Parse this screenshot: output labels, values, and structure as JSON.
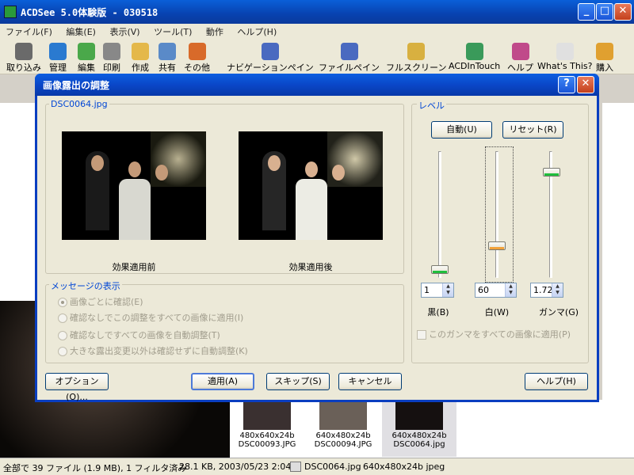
{
  "app": {
    "title": "ACDSee 5.0体験版 - 030518",
    "menu": [
      "ファイル(F)",
      "編集(E)",
      "表示(V)",
      "ツール(T)",
      "動作",
      "ヘルプ(H)"
    ],
    "toolbar": [
      "取り込み",
      "管理",
      "編集",
      "印刷",
      "作成",
      "共有",
      "その他",
      "ナビゲーションペイン",
      "ファイルペイン",
      "フルスクリーン",
      "ACDInTouch",
      "ヘルプ",
      "What's This?",
      "購入"
    ]
  },
  "thumbnails": [
    {
      "dims": "480x640x24b",
      "name": "DSC00093.JPG"
    },
    {
      "dims": "640x480x24b",
      "name": "DSC00094.JPG"
    },
    {
      "dims": "640x480x24b",
      "name": "DSC0064.jpg"
    }
  ],
  "status": {
    "summary": "全部で 39 ファイル (1.9 MB), 1 フィルタ済み",
    "file_info": "28.1 KB, 2003/05/23 2:04",
    "file_name": "DSC0064.jpg",
    "image_info": "640x480x24b jpeg"
  },
  "dialog": {
    "title": "画像露出の調整",
    "preview_group": "DSC0064.jpg",
    "before_label": "効果適用前",
    "after_label": "効果適用後",
    "message_group": "メッセージの表示",
    "options": [
      {
        "label": "画像ごとに確認(E)",
        "selected": true
      },
      {
        "label": "確認なしでこの調整をすべての画像に適用(I)",
        "selected": false
      },
      {
        "label": "確認なしですべての画像を自動調整(T)",
        "selected": false
      },
      {
        "label": "大きな露出変更以外は確認せずに自動調整(K)",
        "selected": false
      }
    ],
    "level_group": "レベル",
    "auto_button": "自動(U)",
    "reset_button": "リセット(R)",
    "black": {
      "value": "1",
      "label": "黒(B)",
      "level": 0.04
    },
    "white": {
      "value": "60",
      "label": "白(W)",
      "level": 0.24
    },
    "gamma": {
      "value": "1.72",
      "label": "ガンマ(G)",
      "level": 0.86
    },
    "gamma_all_label": "このガンマをすべての画像に適用(P)",
    "buttons": {
      "options": "オプション(O)...",
      "apply": "適用(A)",
      "skip": "スキップ(S)",
      "cancel": "キャンセル",
      "help": "ヘルプ(H)"
    }
  }
}
